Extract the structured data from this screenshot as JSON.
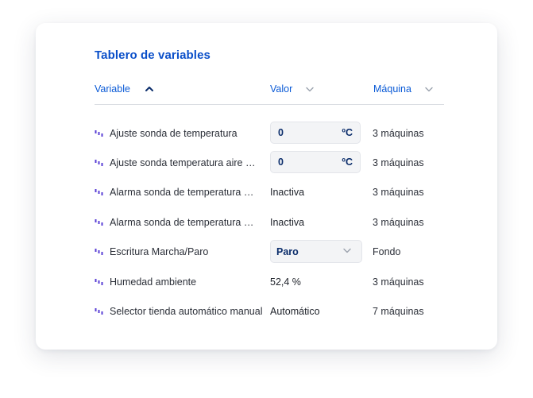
{
  "panel": {
    "title": "Tablero de variables"
  },
  "columns": [
    {
      "label": "Variable",
      "sort_icon": "chevron-up-icon"
    },
    {
      "label": "Valor",
      "sort_icon": "chevron-down-icon"
    },
    {
      "label": "Máquina",
      "sort_icon": "chevron-down-icon"
    }
  ],
  "rows": [
    {
      "icon": "signal-bars-icon",
      "name": "Ajuste sonda de temperatura",
      "value_type": "input",
      "value": "0",
      "unit": "ºC",
      "machine": "3 máquinas"
    },
    {
      "icon": "signal-bars-icon",
      "name": "Ajuste sonda temperatura aire ex...",
      "value_type": "input",
      "value": "0",
      "unit": "ºC",
      "machine": "3 máquinas"
    },
    {
      "icon": "signal-bars-icon",
      "name": "Alarma sonda de temperatura am...",
      "value_type": "text",
      "value": "Inactiva",
      "machine": "3 máquinas"
    },
    {
      "icon": "signal-bars-icon",
      "name": "Alarma sonda de temperatura ext...",
      "value_type": "text",
      "value": "Inactiva",
      "machine": "3 máquinas"
    },
    {
      "icon": "signal-bars-icon",
      "name": "Escritura Marcha/Paro",
      "value_type": "select",
      "value": "Paro",
      "machine": "Fondo"
    },
    {
      "icon": "signal-bars-icon",
      "name": "Humedad ambiente",
      "value_type": "text",
      "value": "52,4 %",
      "machine": "3 máquinas"
    },
    {
      "icon": "signal-bars-icon",
      "name": "Selector tienda automático manual",
      "value_type": "text",
      "value": "Automático",
      "machine": "7 máquinas"
    }
  ],
  "colors": {
    "accent": "#0a5ad6",
    "title": "#0a4fc9",
    "icon_purple": "#5a3fd6",
    "input_text": "#0b2d6b"
  }
}
